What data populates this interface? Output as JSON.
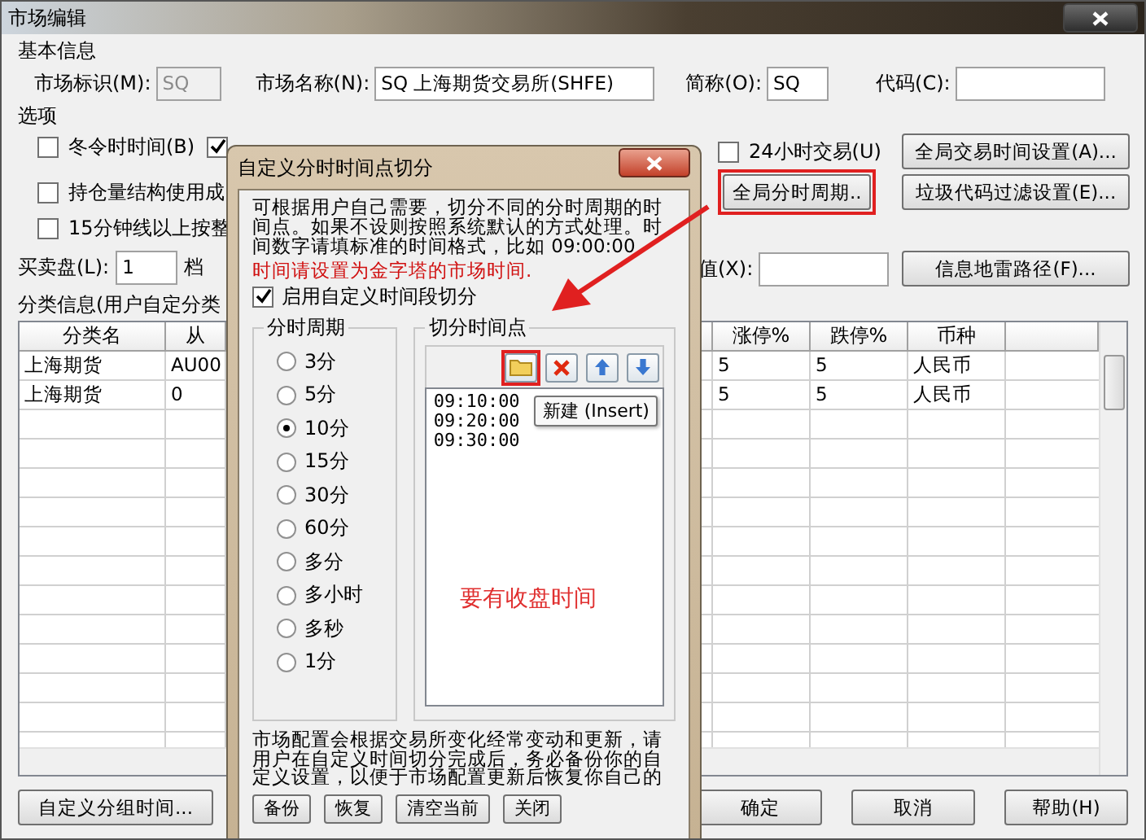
{
  "window": {
    "title": "市场编辑"
  },
  "basic_info": {
    "title": "基本信息",
    "fields": [
      {
        "label": "市场标识(M):",
        "value": "SQ",
        "disabled": true
      },
      {
        "label": "市场名称(N):",
        "value": "SQ 上海期货交易所(SHFE)",
        "disabled": false
      },
      {
        "label": "简称(O):",
        "value": "SQ",
        "disabled": false
      },
      {
        "label": "代码(C):",
        "disabled": false
      }
    ]
  },
  "options": {
    "title": "选项",
    "left_checks": [
      {
        "label": "冬令时时间(B)",
        "checked": false
      },
      {
        "label": "持仓量结构使用成",
        "checked": false
      },
      {
        "label": "15分钟线以上按整",
        "checked": false
      }
    ],
    "partial_check": {
      "checked": true
    },
    "day_check": {
      "label": "24小时交易(U)",
      "checked": false
    },
    "buttons": [
      {
        "label": "全局交易时间设置(A)...",
        "highlighted": false
      },
      {
        "label": "全局分时周期..",
        "highlighted": true
      },
      {
        "label": "垃圾代码过滤设置(E)...",
        "highlighted": false
      },
      {
        "label": "信息地雷路径(F)...",
        "highlighted": false
      }
    ],
    "bid_ask": {
      "label": "买卖盘(L):",
      "value": "1",
      "unit": "档"
    },
    "value_field": {
      "label": "值(X):"
    }
  },
  "category": {
    "title": "分类信息(用户自定分类",
    "columns": [
      "分类名",
      "从",
      "涨停%",
      "跌停%",
      "币种"
    ],
    "rows": [
      [
        "上海期货",
        "AU00",
        "5",
        "5",
        "人民币"
      ],
      [
        "上海期货",
        "0",
        "5",
        "5",
        "人民币"
      ]
    ]
  },
  "footer_buttons": [
    "自定义分组时间...",
    "确定",
    "取消",
    "帮助(H)"
  ],
  "dialog": {
    "title": "自定义分时时间点切分",
    "intro": "可根据用户自己需要，切分不同的分时周期的时间点。如果不设则按照系统默认的方式处理。时间数字请填标准的时间格式，比如 09:00:00",
    "warning": "时间请设置为金字塔的市场时间.",
    "enable": {
      "label": "启用自定义时间段切分",
      "checked": true
    },
    "periods": {
      "title": "分时周期",
      "options": [
        {
          "label": "3分",
          "selected": false
        },
        {
          "label": "5分",
          "selected": false
        },
        {
          "label": "10分",
          "selected": true
        },
        {
          "label": "15分",
          "selected": false
        },
        {
          "label": "30分",
          "selected": false
        },
        {
          "label": "60分",
          "selected": false
        },
        {
          "label": "多分",
          "selected": false
        },
        {
          "label": "多小时",
          "selected": false
        },
        {
          "label": "多秒",
          "selected": false
        },
        {
          "label": "1分",
          "selected": false
        }
      ]
    },
    "points": {
      "title": "切分时间点",
      "tools": [
        {
          "kind": "new",
          "highlighted": true
        },
        {
          "kind": "delete",
          "highlighted": false
        },
        {
          "kind": "up",
          "highlighted": false
        },
        {
          "kind": "down",
          "highlighted": false
        }
      ],
      "tooltip": "新建 (Insert)",
      "items": [
        "09:10:00",
        "09:20:00",
        "09:30:00"
      ]
    },
    "note": "市场配置会根据交易所变化经常变动和更新，请用户在自定义时间切分完成后，务必备份你的自定义设置，以便于市场配置更新后恢复你自己的",
    "buttons": [
      "备份",
      "恢复",
      "清空当前",
      "关闭"
    ]
  },
  "annotation": {
    "text": "要有收盘时间"
  }
}
